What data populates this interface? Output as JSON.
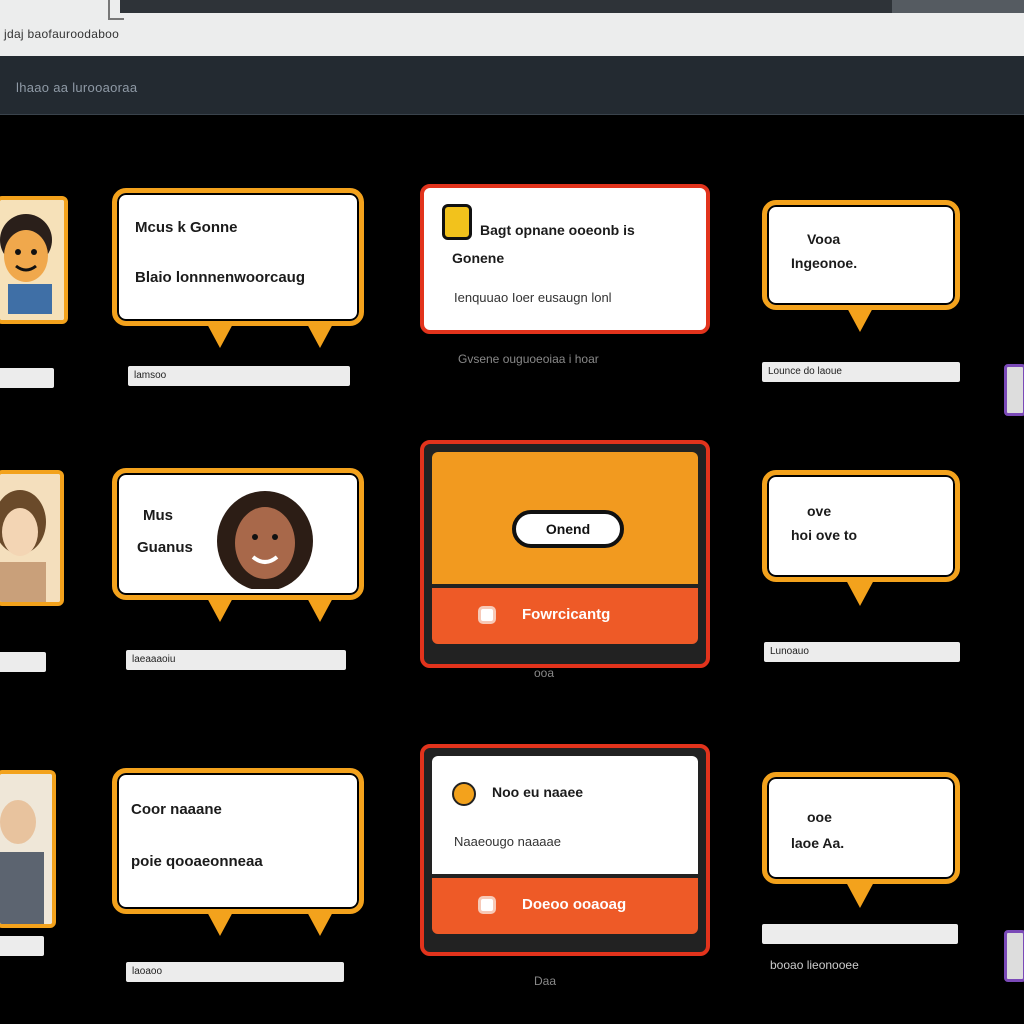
{
  "browser": {
    "address_text": "jdaj baofauroodaboo"
  },
  "toolbar": {
    "title": "lhaao aa lurooaoraa"
  },
  "row1": {
    "avatar_caption": "",
    "bubble_line1": "Mcus k Gonne",
    "bubble_line2": "Blaio lonnnenwoorcaug",
    "bubble_caption": "lamsoo",
    "card_title": "Bagt opnane ooeonb is",
    "card_title2": "Gonene",
    "card_desc": "Ienquuao Ioer eusaugn lonl",
    "card_caption": "Gvsene ouguoeoiaa i hoar",
    "panel_line1": "Vooa",
    "panel_line2": "Ingeonoe.",
    "panel_caption": "Lounce do laoue"
  },
  "row2": {
    "avatar_caption": "",
    "bubble_line1": "Mus",
    "bubble_line2": "Guanus",
    "bubble_caption": "laeaaaoiu",
    "card_button": "Onend",
    "card_action": "Fowrcicantg",
    "card_caption": "ooa",
    "panel_line1": "ove",
    "panel_line2": "hoi ove to",
    "panel_caption": "Lunoauo"
  },
  "row3": {
    "avatar_caption": "",
    "bubble_line1": "Coor naaane",
    "bubble_line2": "poie qooaeonneaa",
    "bubble_caption": "laoaoo",
    "card_title": "Noo eu naaee",
    "card_desc": "Naaeougo naaaae",
    "card_action": "Doeoo ooaoag",
    "card_caption": "Daa",
    "panel_line1": "ooe",
    "panel_line2": "laoe Aa.",
    "panel_caption": "booao lieonooee"
  }
}
